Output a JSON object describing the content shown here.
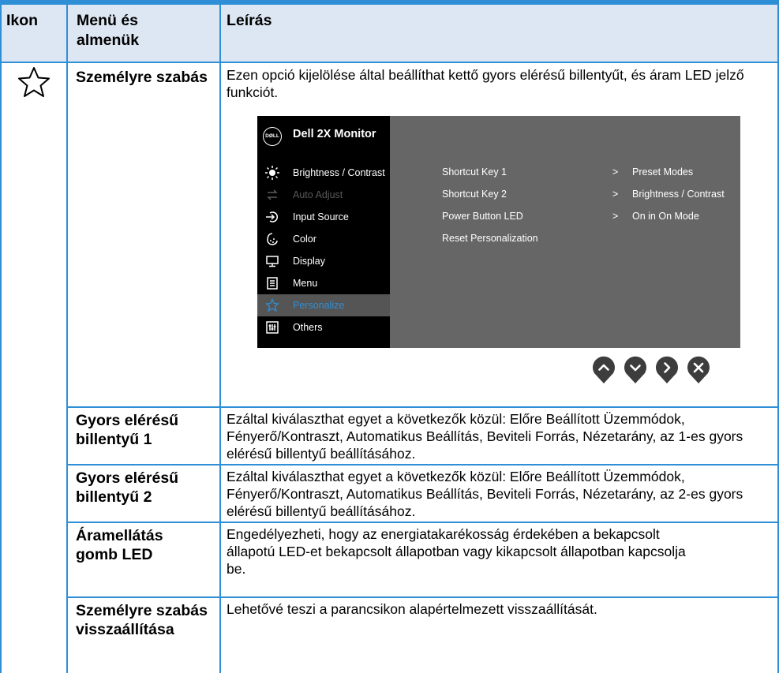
{
  "header": {
    "col_icon": "Ikon",
    "col_menu": "Menü és almenük",
    "col_desc": "Leírás"
  },
  "personalize": {
    "icon": "star-outline-icon",
    "title": "Személyre szabás",
    "description": "Ezen opció kijelölése által beállíthat kettő gyors elérésű billentyűt, és áram LED jelző funkciót."
  },
  "osd": {
    "brand": "DØLL",
    "title": "Dell 2X Monitor",
    "menu": [
      {
        "label": "Brightness / Contrast",
        "icon": "brightness-icon",
        "state": "normal"
      },
      {
        "label": "Auto Adjust",
        "icon": "auto-adjust-icon",
        "state": "disabled"
      },
      {
        "label": "Input Source",
        "icon": "input-source-icon",
        "state": "normal"
      },
      {
        "label": "Color",
        "icon": "color-icon",
        "state": "normal"
      },
      {
        "label": "Display",
        "icon": "display-icon",
        "state": "normal"
      },
      {
        "label": "Menu",
        "icon": "menu-icon",
        "state": "normal"
      },
      {
        "label": "Personalize",
        "icon": "star-icon",
        "state": "selected"
      },
      {
        "label": "Others",
        "icon": "others-icon",
        "state": "normal"
      }
    ],
    "options": [
      {
        "label": "Shortcut Key 1",
        "value": "Preset Modes"
      },
      {
        "label": "Shortcut Key 2",
        "value": "Brightness / Contrast"
      },
      {
        "label": "Power Button LED",
        "value": "On in On Mode"
      },
      {
        "label": "Reset Personalization",
        "value": ""
      }
    ],
    "arrow": ">",
    "nav_buttons": [
      "up-icon",
      "down-icon",
      "right-icon",
      "close-icon"
    ]
  },
  "rows": [
    {
      "title": "Gyors elérésű billentyű 1",
      "description": "Ezáltal kiválaszthat egyet a következők közül: Előre Beállított Üzemmódok, Fényerő/Kontraszt, Automatikus Beállítás, Beviteli Forrás, Nézetarány, az 1-es gyors elérésű billentyű beállításához."
    },
    {
      "title": "Gyors elérésű billentyű 2",
      "description": "Ezáltal kiválaszthat egyet a következők közül: Előre Beállított Üzemmódok, Fényerő/Kontraszt, Automatikus Beállítás, Beviteli Forrás, Nézetarány, az 2-es gyors elérésű billentyű beállításához."
    },
    {
      "title": "Áramellátás gomb LED",
      "description": "Engedélyezheti, hogy az energiatakarékosság érdekében a bekapcsolt állapotú LED-et bekapcsolt állapotban vagy kikapcsolt állapotban kapcsolja be."
    },
    {
      "title": "Személyre szabás visszaállítása",
      "description": "Lehetővé teszi a parancsikon alapértelmezett visszaállítását."
    }
  ],
  "colors": {
    "border": "#2f8fd6",
    "header_bg": "#dde7f3",
    "osd_panel": "#666666",
    "osd_menu_bg": "#000000",
    "osd_selected": "#2f8fd6",
    "nav_button": "#3d3d3d"
  }
}
